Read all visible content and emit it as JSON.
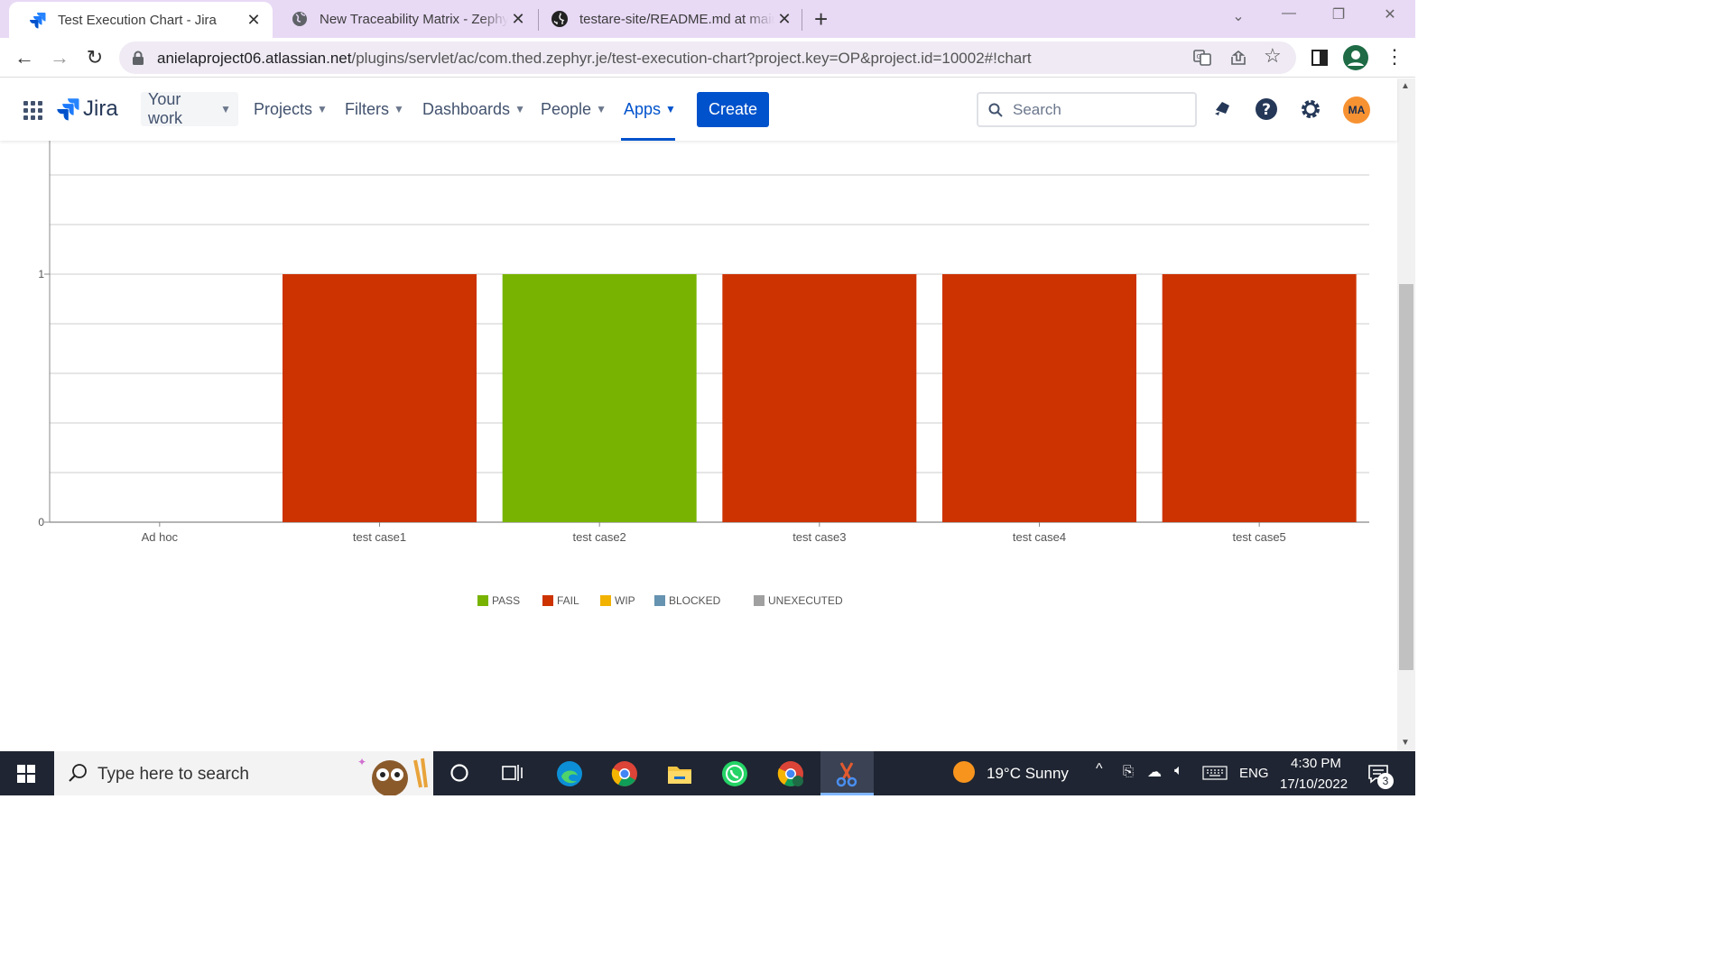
{
  "browser": {
    "tabs": [
      {
        "title": "Test Execution Chart - Jira",
        "icon": "jira-icon",
        "active": true
      },
      {
        "title": "New Traceability Matrix - Zephyr",
        "icon": "globe-icon",
        "active": false
      },
      {
        "title": "testare-site/README.md at main",
        "icon": "github-icon",
        "active": false
      }
    ],
    "url_host": "anielaproject06.atlassian.net",
    "url_path": "/plugins/servlet/ac/com.thed.zephyr.je/test-execution-chart?project.key=OP&project.id=10002#!chart"
  },
  "jira": {
    "product": "Jira",
    "nav": [
      {
        "label": "Your work"
      },
      {
        "label": "Projects"
      },
      {
        "label": "Filters"
      },
      {
        "label": "Dashboards"
      },
      {
        "label": "People"
      },
      {
        "label": "Apps",
        "selected": true
      }
    ],
    "create_label": "Create",
    "search_placeholder": "Search",
    "avatar_initials": "MA",
    "colors": {
      "brand": "#0052cc",
      "avatar": "#f79232"
    }
  },
  "chart_data": {
    "type": "bar",
    "stacked": true,
    "categories": [
      "Ad hoc",
      "test case1",
      "test case2",
      "test case3",
      "test case4",
      "test case5"
    ],
    "series": [
      {
        "name": "PASS",
        "color": "#77b300",
        "values": [
          0,
          0,
          1,
          0,
          0,
          0
        ]
      },
      {
        "name": "FAIL",
        "color": "#cc3300",
        "values": [
          0,
          1,
          0,
          1,
          1,
          1
        ]
      },
      {
        "name": "WIP",
        "color": "#f2b200",
        "values": [
          0,
          0,
          0,
          0,
          0,
          0
        ]
      },
      {
        "name": "BLOCKED",
        "color": "#6693b0",
        "values": [
          0,
          0,
          0,
          0,
          0,
          0
        ]
      },
      {
        "name": "UNEXECUTED",
        "color": "#a0a0a0",
        "values": [
          0,
          0,
          0,
          0,
          0,
          0
        ]
      }
    ],
    "yticks": [
      "0",
      "1"
    ],
    "ylim": [
      0,
      2
    ],
    "grid": true,
    "legend_position": "bottom"
  },
  "taskbar": {
    "search_placeholder": "Type here to search",
    "weather": "19°C  Sunny",
    "language": "ENG",
    "time": "4:30 PM",
    "date": "17/10/2022",
    "notifications": "3"
  }
}
